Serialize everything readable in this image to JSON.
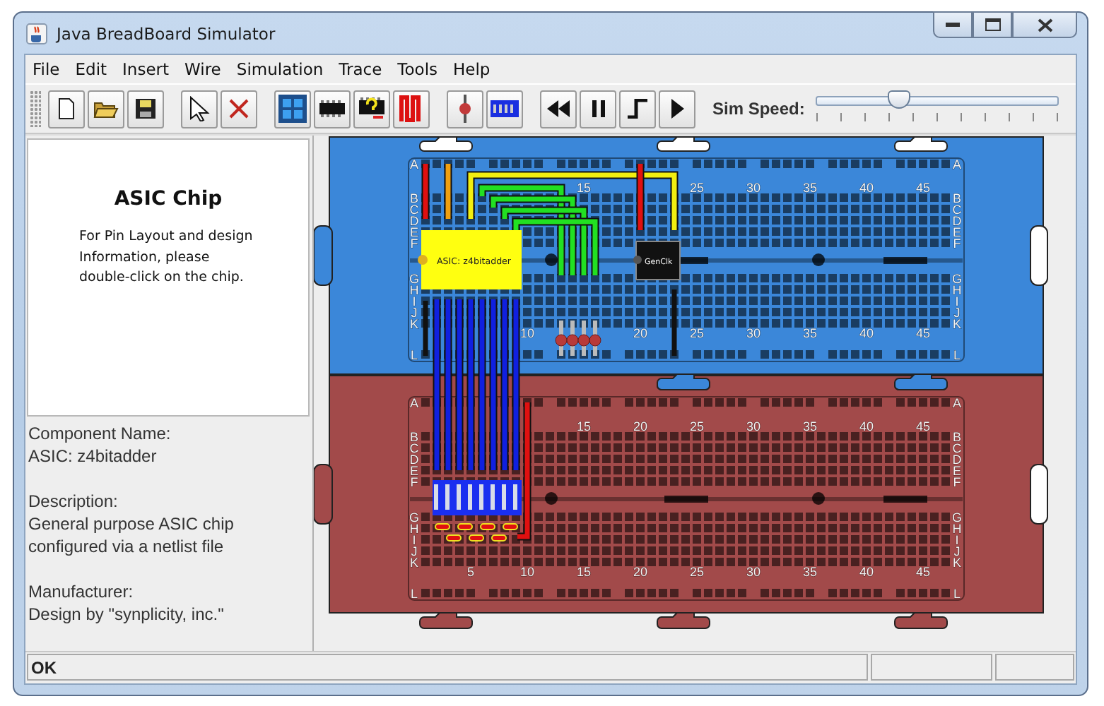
{
  "window": {
    "title": "Java BreadBoard Simulator"
  },
  "menu": [
    "File",
    "Edit",
    "Insert",
    "Wire",
    "Simulation",
    "Trace",
    "Tools",
    "Help"
  ],
  "sim_speed": {
    "label": "Sim Speed:",
    "level": 0.34
  },
  "info_panel": {
    "title": "ASIC Chip",
    "text": "For Pin Layout and design\nInformation, please\ndouble-click on the chip.",
    "details": [
      {
        "label": "Component Name:",
        "value": "ASIC: z4bitadder"
      },
      {
        "label": "Description:",
        "value": "General purpose ASIC chip\nconfigured via a netlist file"
      },
      {
        "label": "Manufacturer:",
        "value": "Design by \"synplicity, inc.\""
      }
    ]
  },
  "boards": [
    {
      "color": "#3b87d9",
      "row_labels_left": [
        "A",
        "B",
        "C",
        "D",
        "E",
        "F",
        "G",
        "H",
        "I",
        "J",
        "K",
        "L"
      ],
      "row_labels_right": [
        "A",
        "B",
        "C",
        "D",
        "E",
        "F",
        "G",
        "H",
        "I",
        "J",
        "K",
        "L"
      ],
      "top_numbers": [
        "15",
        "25",
        "30",
        "35",
        "40",
        "45"
      ],
      "bottom_numbers": [
        "10",
        "20",
        "25",
        "30",
        "35",
        "40",
        "45"
      ]
    },
    {
      "color": "#a24a4a",
      "row_labels_left": [
        "A",
        "B",
        "C",
        "D",
        "E",
        "F",
        "G",
        "H",
        "I",
        "J",
        "K",
        "L"
      ],
      "row_labels_right": [
        "A",
        "B",
        "C",
        "D",
        "E",
        "F",
        "G",
        "H",
        "I",
        "J",
        "K",
        "L"
      ],
      "top_numbers": [
        "15",
        "20",
        "25",
        "30",
        "35",
        "40",
        "45"
      ],
      "bottom_numbers": [
        "5",
        "10",
        "15",
        "20",
        "25",
        "30",
        "35",
        "40",
        "45"
      ]
    }
  ],
  "dip_switch": {
    "switches": [
      {
        "on": true
      },
      {
        "on": true
      },
      {
        "on": true
      },
      {
        "on": true
      },
      {
        "on": true
      },
      {
        "on": true
      },
      {
        "on": true
      },
      {
        "on": true
      }
    ]
  },
  "chips": [
    {
      "label": "ASIC: z4bitadder"
    },
    {
      "label": "GenClk"
    }
  ],
  "status_bar": {
    "text": "OK"
  }
}
